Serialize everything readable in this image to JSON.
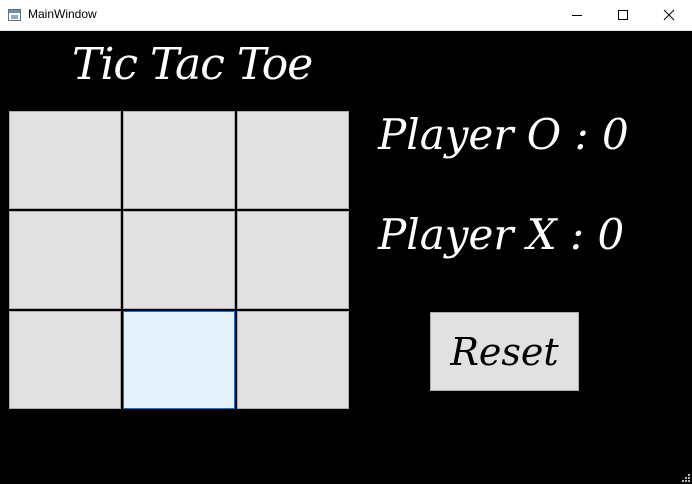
{
  "window": {
    "title": "MainWindow",
    "app_icon": "window-app-icon",
    "controls": {
      "minimize_icon": "minimize-icon",
      "maximize_icon": "maximize-icon",
      "close_icon": "close-icon"
    }
  },
  "game": {
    "title": "Tic Tac Toe",
    "board": [
      "",
      "",
      "",
      "",
      "",
      "",
      "",
      "",
      ""
    ],
    "scores": {
      "player_o": "Player O : 0",
      "player_x": "Player X : 0"
    },
    "reset_label": "Reset"
  },
  "colors": {
    "background": "#000000",
    "cell": "#e1e1e1",
    "cell_hover": "#e5f1fb",
    "hover_border": "#0078d7",
    "text": "#ffffff"
  }
}
